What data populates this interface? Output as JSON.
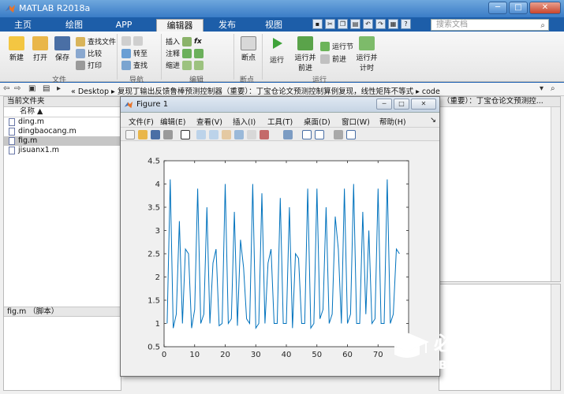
{
  "window": {
    "title": "MATLAB R2018a",
    "min_label": "─",
    "max_label": "□",
    "close_label": "✕"
  },
  "tabs": [
    "主页",
    "绘图",
    "APP",
    "编辑器",
    "发布",
    "视图"
  ],
  "search": {
    "placeholder": "搜索文档"
  },
  "ribbon": {
    "file_group": {
      "label": "文件",
      "new": "新建",
      "open": "打开",
      "save": "保存",
      "find_files": "查找文件",
      "compare": "比较",
      "print": "打印"
    },
    "nav_group": {
      "label": "导航",
      "goto": "转至",
      "find": "查找"
    },
    "edit_group": {
      "label": "编辑",
      "insert": "插入",
      "comment": "注释",
      "indent": "缩进",
      "fx": "fx"
    },
    "breakpoints_group": {
      "label": "断点",
      "breakpoints": "断点"
    },
    "run_group": {
      "label": "运行",
      "run": "运行",
      "run_advance": "运行并\n前进",
      "run_section": "运行节",
      "advance": "前进",
      "run_time": "运行并\n计时"
    }
  },
  "address": {
    "path": "«  Desktop  ▸  复现丁输出反馈鲁棒预测控制器（重要）：丁宝仓论文预测控制算例复现，线性矩阵不等式  ▸  code"
  },
  "current_folder": {
    "title": "当前文件夹",
    "column": "名称 ▲",
    "files": [
      {
        "name": "ding.m",
        "selected": false
      },
      {
        "name": "dingbaocang.m",
        "selected": false
      },
      {
        "name": "fig.m",
        "selected": true
      },
      {
        "name": "jisuanx1.m",
        "selected": false
      }
    ],
    "details": "fig.m （脚本）"
  },
  "editor": {
    "title": "（重要）：丁宝仓论文预测控..."
  },
  "figure": {
    "title": "Figure 1",
    "menu": [
      "文件(F)",
      "编辑(E)",
      "查看(V)",
      "插入(I)",
      "工具(T)",
      "桌面(D)",
      "窗口(W)",
      "帮助(H)"
    ]
  },
  "chart_data": {
    "type": "line",
    "title": "",
    "xlabel": "",
    "ylabel": "",
    "xlim": [
      0,
      80
    ],
    "ylim": [
      0.5,
      4.5
    ],
    "xticks": [
      0,
      10,
      20,
      30,
      40,
      50,
      60,
      70
    ],
    "yticks": [
      0.5,
      1,
      1.5,
      2,
      2.5,
      3,
      3.5,
      4,
      4.5
    ],
    "color": "#0072bd",
    "x": [
      1,
      2,
      3,
      4,
      5,
      6,
      7,
      8,
      9,
      10,
      11,
      12,
      13,
      14,
      15,
      16,
      17,
      18,
      19,
      20,
      21,
      22,
      23,
      24,
      25,
      26,
      27,
      28,
      29,
      30,
      31,
      32,
      33,
      34,
      35,
      36,
      37,
      38,
      39,
      40,
      41,
      42,
      43,
      44,
      45,
      46,
      47,
      48,
      49,
      50,
      51,
      52,
      53,
      54,
      55,
      56,
      57,
      58,
      59,
      60,
      61,
      62,
      63,
      64,
      65,
      66,
      67,
      68,
      69,
      70,
      71,
      72,
      73,
      74,
      75,
      76,
      77
    ],
    "y": [
      1.0,
      4.1,
      0.9,
      1.2,
      3.2,
      1.0,
      2.6,
      2.5,
      0.9,
      1.3,
      3.9,
      1.0,
      1.2,
      3.5,
      1.0,
      2.3,
      2.6,
      0.95,
      1.0,
      4.0,
      1.0,
      1.1,
      3.4,
      0.95,
      2.8,
      2.2,
      1.1,
      1.0,
      4.0,
      0.9,
      1.0,
      3.8,
      1.0,
      2.3,
      2.6,
      1.0,
      1.0,
      3.7,
      1.0,
      1.0,
      3.5,
      0.9,
      2.5,
      2.4,
      1.0,
      1.0,
      3.9,
      0.9,
      1.0,
      3.9,
      1.1,
      1.3,
      3.5,
      1.0,
      1.2,
      3.3,
      2.6,
      1.0,
      3.9,
      1.0,
      1.2,
      4.0,
      1.0,
      1.0,
      3.4,
      1.2,
      3.0,
      1.0,
      1.1,
      3.9,
      1.0,
      1.0,
      4.1,
      1.0,
      1.2,
      2.6,
      2.5
    ]
  },
  "logo": {
    "title": "必过源码",
    "url": "Biguo100.com"
  }
}
